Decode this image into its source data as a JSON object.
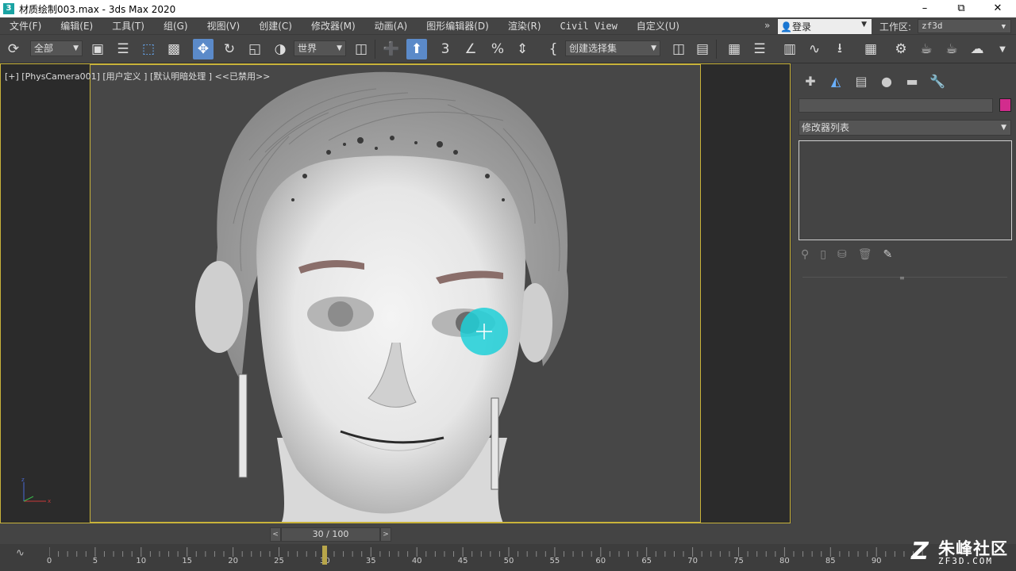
{
  "window": {
    "title": "材质绘制003.max - 3ds Max 2020",
    "app_icon": "3",
    "controls": [
      "minimize-icon",
      "restore-icon",
      "close-icon"
    ]
  },
  "menubar": {
    "items": [
      "文件(F)",
      "编辑(E)",
      "工具(T)",
      "组(G)",
      "视图(V)",
      "创建(C)",
      "修改器(M)",
      "动画(A)",
      "图形编辑器(D)",
      "渲染(R)",
      "Civil View",
      "自定义(U)"
    ],
    "overflow": "»",
    "login_label": "登录",
    "workspace_label": "工作区:",
    "workspace_value": "zf3d"
  },
  "toolbar": {
    "selection_filter": "全部",
    "reference_coord": "世界",
    "named_selection": "创建选择集"
  },
  "viewport": {
    "label": "[+] [PhysCamera001] [用户定义 ] [默认明暗处理 ] <<已禁用>>",
    "colors": {
      "active_border": "#c9b33a",
      "brush_cursor": "#1fd0d8"
    }
  },
  "command_panel": {
    "modifier_list": "修改器列表",
    "object_color": "#d22c8d",
    "tabs": [
      "create-icon",
      "modify-icon",
      "hierarchy-icon",
      "motion-icon",
      "display-icon",
      "utilities-icon"
    ]
  },
  "timeline": {
    "current_frame": "30 / 100",
    "frame_value": 30,
    "frame_total": 100,
    "tick_labels": [
      "0",
      "5",
      "10",
      "15",
      "20",
      "25",
      "30",
      "35",
      "40",
      "45",
      "50",
      "55",
      "60",
      "65",
      "70",
      "75",
      "80",
      "85",
      "90"
    ]
  },
  "watermark": {
    "main": "朱峰社区",
    "sub": "ZF3D.COM"
  }
}
